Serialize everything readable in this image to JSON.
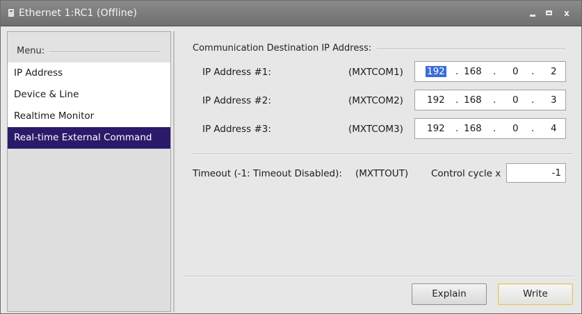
{
  "window": {
    "title": "Ethernet 1:RC1 (Offline)",
    "controls": {
      "minimize": "minimize",
      "maximize": "maximize",
      "close": "x"
    }
  },
  "menu": {
    "header": "Menu:",
    "items": [
      {
        "label": "IP Address",
        "selected": false
      },
      {
        "label": "Device & Line",
        "selected": false
      },
      {
        "label": "Realtime Monitor",
        "selected": false
      },
      {
        "label": "Real-time External Command",
        "selected": true
      }
    ]
  },
  "main": {
    "group_title": "Communication Destination IP Address:",
    "ip_rows": [
      {
        "label": "IP Address #1:",
        "param": "(MXTCOM1)",
        "octets": [
          "192",
          "168",
          "0",
          "2"
        ],
        "selected_octet": 0
      },
      {
        "label": "IP Address #2:",
        "param": "(MXTCOM2)",
        "octets": [
          "192",
          "168",
          "0",
          "3"
        ]
      },
      {
        "label": "IP Address #3:",
        "param": "(MXTCOM3)",
        "octets": [
          "192",
          "168",
          "0",
          "4"
        ]
      }
    ],
    "timeout": {
      "label": "Timeout (-1: Timeout Disabled):",
      "param": "(MXTTOUT)",
      "unit": "Control cycle x",
      "value": "-1"
    },
    "buttons": {
      "explain": "Explain",
      "write": "Write"
    }
  },
  "colors": {
    "selected_menu_bg": "#2a1a6a",
    "selection_highlight": "#3a6bd8",
    "write_button_border": "#e4c36a"
  }
}
